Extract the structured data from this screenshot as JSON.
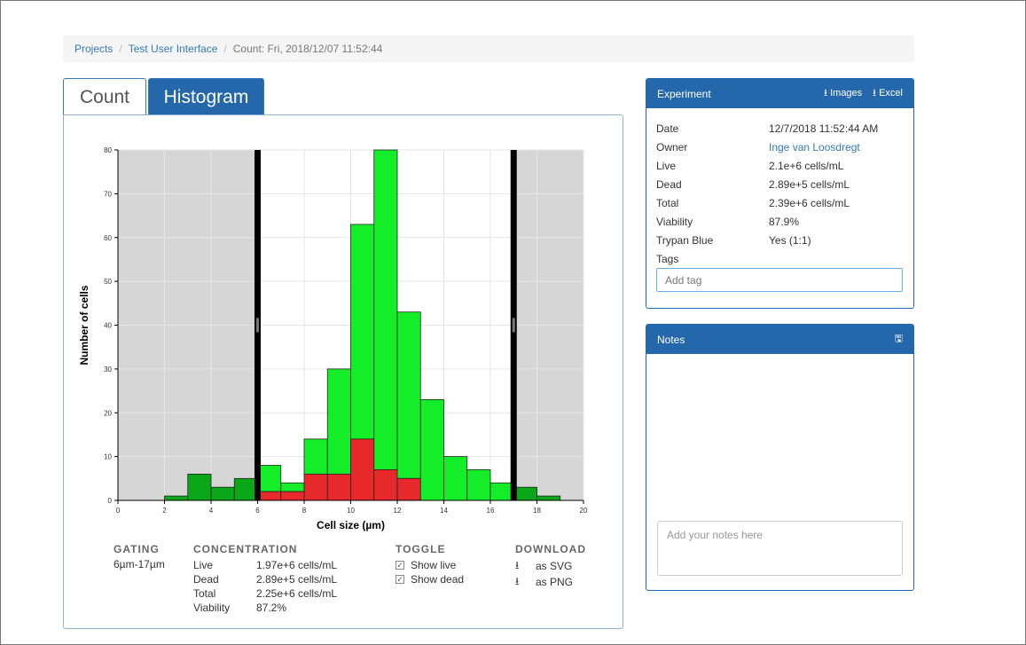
{
  "breadcrumb": {
    "items": [
      "Projects",
      "Test User Interface"
    ],
    "current": "Count: Fri, 2018/12/07 11:52:44"
  },
  "tabs": [
    {
      "label": "Count",
      "active": false
    },
    {
      "label": "Histogram",
      "active": true
    }
  ],
  "chart_data": {
    "type": "bar",
    "xlabel": "Cell size (µm)",
    "ylabel": "Number of cells",
    "xlim": [
      0,
      20
    ],
    "ylim": [
      0,
      80
    ],
    "xticks": [
      0,
      2,
      4,
      6,
      8,
      10,
      12,
      14,
      16,
      18,
      20
    ],
    "yticks": [
      0,
      10,
      20,
      30,
      40,
      50,
      60,
      70,
      80
    ],
    "grid": true,
    "bin_width": 1,
    "bins": [
      2,
      3,
      4,
      5,
      6,
      7,
      8,
      9,
      10,
      11,
      12,
      13,
      14,
      15,
      16,
      17,
      18
    ],
    "series": [
      {
        "values": [
          1,
          6,
          3,
          5,
          6,
          2,
          8,
          24,
          49,
          73,
          38,
          23,
          10,
          7,
          4,
          3,
          1
        ],
        "color": "#14ee28"
      },
      {
        "values": [
          0,
          0,
          0,
          0,
          2,
          2,
          6,
          6,
          14,
          7,
          5,
          0,
          0,
          0,
          0,
          0,
          0
        ],
        "color": "#e8292b"
      }
    ],
    "gates": [
      6,
      17
    ],
    "gated_out_color": "#d6d6d6",
    "out_of_gate_live_color": "#0aa818"
  },
  "stats": {
    "gating": {
      "head": "GATING",
      "value": "6µm-17µm"
    },
    "concentration": {
      "head": "CONCENTRATION",
      "rows": [
        {
          "k": "Live",
          "v": "1.97e+6 cells/mL"
        },
        {
          "k": "Dead",
          "v": "2.89e+5 cells/mL"
        },
        {
          "k": "Total",
          "v": "2.25e+6 cells/mL"
        },
        {
          "k": "Viability",
          "v": "87.2%"
        }
      ]
    },
    "toggle": {
      "head": "TOGGLE",
      "live": "Show live",
      "dead": "Show dead"
    },
    "download": {
      "head": "DOWNLOAD",
      "svg": "as SVG",
      "png": "as PNG"
    }
  },
  "experiment": {
    "title": "Experiment",
    "images_label": "Images",
    "excel_label": "Excel",
    "rows": [
      {
        "k": "Date",
        "v": "12/7/2018 11:52:44 AM"
      },
      {
        "k": "Owner",
        "v": "Inge van Loosdregt"
      },
      {
        "k": "Live",
        "v": "2.1e+6 cells/mL"
      },
      {
        "k": "Dead",
        "v": "2.89e+5 cells/mL"
      },
      {
        "k": "Total",
        "v": "2.39e+6 cells/mL"
      },
      {
        "k": "Viability",
        "v": "87.9%"
      },
      {
        "k": "Trypan Blue",
        "v": "Yes (1:1)"
      },
      {
        "k": "Tags",
        "v": ""
      }
    ],
    "tag_placeholder": "Add tag"
  },
  "notes": {
    "title": "Notes",
    "placeholder": "Add your notes here"
  },
  "colors": {
    "primary": "#2567ab",
    "link": "#337ab7"
  }
}
